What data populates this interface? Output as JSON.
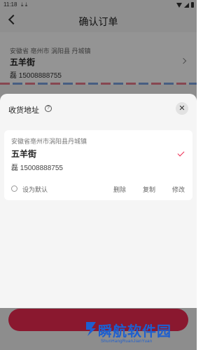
{
  "status_bar": {
    "time": "11:18",
    "download_icons": "⤓ ⤓"
  },
  "header": {
    "title": "确认订单"
  },
  "background_address": {
    "region": "安徽省 亳州市 涡阳县 丹城镇",
    "name": "五羊街",
    "phone": "磊 15008888755"
  },
  "sheet": {
    "title": "收货地址",
    "help_glyph": "?",
    "close_glyph": "✕",
    "address": {
      "region": "安徽省亳州市涡阳县丹城镇",
      "name": "五羊街",
      "phone": "磊 15008888755"
    },
    "set_default_label": "设为默认",
    "actions": {
      "delete": "删除",
      "copy": "复制",
      "edit": "修改"
    }
  },
  "watermark": {
    "main": "瞬航软件园",
    "sub": "ShunHangRuanJianYuan"
  },
  "colors": {
    "accent": "#ee2a51",
    "watermark": "#1d5fd0"
  }
}
